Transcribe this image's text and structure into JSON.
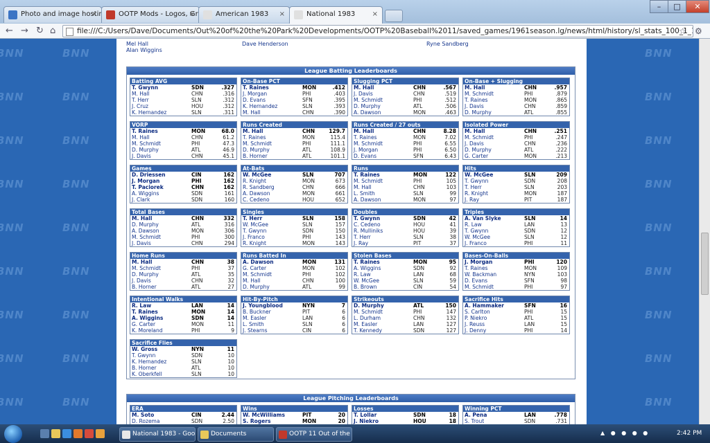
{
  "browser": {
    "tabs": [
      {
        "label": "Photo and image hosting,",
        "icon_color": "#3b74c4"
      },
      {
        "label": "OOTP Mods - Logos, Grap",
        "icon_color": "#c0392b"
      },
      {
        "label": "American 1983",
        "icon_color": "#e0e0e0"
      },
      {
        "label": "National 1983",
        "icon_color": "#e0e0e0"
      }
    ],
    "url": "file:///C:/Users/Dave/Documents/Out%20of%20the%20Park%20Developments/OOTP%20Baseball%2011/saved_games/1961season.lg/news/html/history/sl_stats_100_1_1983.html"
  },
  "top_names": {
    "col1": [
      "Mel Hall",
      "Alan Wiggins"
    ],
    "col2": [
      "Dave Henderson"
    ],
    "col3": [
      "Ryne Sandberg"
    ]
  },
  "watermark": "BNN",
  "batting": {
    "title": "League Batting Leaderboards",
    "boxes": [
      {
        "title": "Batting AVG",
        "rows": [
          [
            "T. Gwynn",
            "SDN",
            ".327"
          ],
          [
            "M. Hall",
            "CHN",
            ".316"
          ],
          [
            "T. Herr",
            "SLN",
            ".312"
          ],
          [
            "J. Cruz",
            "HOU",
            ".312"
          ],
          [
            "K. Hernandez",
            "SLN",
            ".311"
          ]
        ]
      },
      {
        "title": "On-Base PCT",
        "rows": [
          [
            "T. Raines",
            "MON",
            ".412"
          ],
          [
            "J. Morgan",
            "PHI",
            ".403"
          ],
          [
            "D. Evans",
            "SFN",
            ".395"
          ],
          [
            "K. Hernandez",
            "SLN",
            ".393"
          ],
          [
            "M. Hall",
            "CHN",
            ".390"
          ]
        ]
      },
      {
        "title": "Slugging PCT",
        "rows": [
          [
            "M. Hall",
            "CHN",
            ".567"
          ],
          [
            "J. Davis",
            "CHN",
            ".519"
          ],
          [
            "M. Schmidt",
            "PHI",
            ".512"
          ],
          [
            "D. Murphy",
            "ATL",
            ".506"
          ],
          [
            "A. Dawson",
            "MON",
            ".463"
          ]
        ]
      },
      {
        "title": "On-Base + Slugging",
        "rows": [
          [
            "M. Hall",
            "CHN",
            ".957"
          ],
          [
            "M. Schmidt",
            "PHI",
            ".879"
          ],
          [
            "T. Raines",
            "MON",
            ".865"
          ],
          [
            "J. Davis",
            "CHN",
            ".859"
          ],
          [
            "D. Murphy",
            "ATL",
            ".855"
          ]
        ]
      },
      {
        "title": "VORP",
        "rows": [
          [
            "T. Raines",
            "MON",
            "68.0"
          ],
          [
            "M. Hall",
            "CHN",
            "61.2"
          ],
          [
            "M. Schmidt",
            "PHI",
            "47.3"
          ],
          [
            "D. Murphy",
            "ATL",
            "46.9"
          ],
          [
            "J. Davis",
            "CHN",
            "45.1"
          ]
        ]
      },
      {
        "title": "Runs Created",
        "rows": [
          [
            "M. Hall",
            "CHN",
            "129.7"
          ],
          [
            "T. Raines",
            "MON",
            "115.4"
          ],
          [
            "M. Schmidt",
            "PHI",
            "111.1"
          ],
          [
            "D. Murphy",
            "ATL",
            "108.9"
          ],
          [
            "B. Horner",
            "ATL",
            "101.1"
          ]
        ]
      },
      {
        "title": "Runs Created / 27 outs",
        "rows": [
          [
            "M. Hall",
            "CHN",
            "8.28"
          ],
          [
            "T. Raines",
            "MON",
            "7.02"
          ],
          [
            "M. Schmidt",
            "PHI",
            "6.55"
          ],
          [
            "J. Morgan",
            "PHI",
            "6.50"
          ],
          [
            "D. Evans",
            "SFN",
            "6.43"
          ]
        ]
      },
      {
        "title": "Isolated Power",
        "rows": [
          [
            "M. Hall",
            "CHN",
            ".251"
          ],
          [
            "M. Schmidt",
            "PHI",
            ".247"
          ],
          [
            "J. Davis",
            "CHN",
            ".236"
          ],
          [
            "D. Murphy",
            "ATL",
            ".222"
          ],
          [
            "G. Carter",
            "MON",
            ".213"
          ]
        ]
      },
      {
        "title": "Games",
        "rows": [
          [
            "D. Driessen",
            "CIN",
            "162"
          ],
          [
            "J. Morgan",
            "PHI",
            "162"
          ],
          [
            "T. Paciorek",
            "CHN",
            "162"
          ],
          [
            "A. Wiggins",
            "SDN",
            "161"
          ],
          [
            "J. Clark",
            "SDN",
            "160"
          ]
        ],
        "leads": 3
      },
      {
        "title": "At-Bats",
        "rows": [
          [
            "W. McGee",
            "SLN",
            "707"
          ],
          [
            "R. Knight",
            "MON",
            "673"
          ],
          [
            "R. Sandberg",
            "CHN",
            "666"
          ],
          [
            "A. Dawson",
            "MON",
            "661"
          ],
          [
            "C. Cedeno",
            "HOU",
            "652"
          ]
        ]
      },
      {
        "title": "Runs",
        "rows": [
          [
            "T. Raines",
            "MON",
            "122"
          ],
          [
            "M. Schmidt",
            "PHI",
            "105"
          ],
          [
            "M. Hall",
            "CHN",
            "103"
          ],
          [
            "L. Smith",
            "SLN",
            "99"
          ],
          [
            "A. Dawson",
            "MON",
            "97"
          ]
        ]
      },
      {
        "title": "Hits",
        "rows": [
          [
            "W. McGee",
            "SLN",
            "209"
          ],
          [
            "T. Gwynn",
            "SDN",
            "208"
          ],
          [
            "T. Herr",
            "SLN",
            "203"
          ],
          [
            "R. Knight",
            "MON",
            "187"
          ],
          [
            "J. Ray",
            "PIT",
            "187"
          ]
        ]
      },
      {
        "title": "Total Bases",
        "rows": [
          [
            "M. Hall",
            "CHN",
            "332"
          ],
          [
            "D. Murphy",
            "ATL",
            "316"
          ],
          [
            "A. Dawson",
            "MON",
            "306"
          ],
          [
            "M. Schmidt",
            "PHI",
            "300"
          ],
          [
            "J. Davis",
            "CHN",
            "294"
          ]
        ]
      },
      {
        "title": "Singles",
        "rows": [
          [
            "T. Herr",
            "SLN",
            "158"
          ],
          [
            "W. McGee",
            "SLN",
            "157"
          ],
          [
            "T. Gwynn",
            "SDN",
            "150"
          ],
          [
            "J. Franco",
            "PHI",
            "143"
          ],
          [
            "R. Knight",
            "MON",
            "143"
          ]
        ]
      },
      {
        "title": "Doubles",
        "rows": [
          [
            "T. Gwynn",
            "SDN",
            "42"
          ],
          [
            "C. Cedeno",
            "HOU",
            "41"
          ],
          [
            "R. Mulliniks",
            "HOU",
            "39"
          ],
          [
            "T. Herr",
            "SLN",
            "38"
          ],
          [
            "J. Ray",
            "PIT",
            "37"
          ]
        ]
      },
      {
        "title": "Triples",
        "rows": [
          [
            "A. Van Slyke",
            "SLN",
            "14"
          ],
          [
            "R. Law",
            "LAN",
            "13"
          ],
          [
            "T. Gwynn",
            "SDN",
            "12"
          ],
          [
            "W. McGee",
            "SLN",
            "12"
          ],
          [
            "J. Franco",
            "PHI",
            "11"
          ]
        ]
      },
      {
        "title": "Home Runs",
        "rows": [
          [
            "M. Hall",
            "CHN",
            "38"
          ],
          [
            "M. Schmidt",
            "PHI",
            "37"
          ],
          [
            "D. Murphy",
            "ATL",
            "35"
          ],
          [
            "J. Davis",
            "CHN",
            "32"
          ],
          [
            "B. Horner",
            "ATL",
            "27"
          ]
        ]
      },
      {
        "title": "Runs Batted In",
        "rows": [
          [
            "A. Dawson",
            "MON",
            "131"
          ],
          [
            "G. Carter",
            "MON",
            "102"
          ],
          [
            "M. Schmidt",
            "PHI",
            "102"
          ],
          [
            "M. Hall",
            "CHN",
            "100"
          ],
          [
            "D. Murphy",
            "ATL",
            "99"
          ]
        ]
      },
      {
        "title": "Stolen Bases",
        "rows": [
          [
            "T. Raines",
            "MON",
            "95"
          ],
          [
            "A. Wiggins",
            "SDN",
            "92"
          ],
          [
            "R. Law",
            "LAN",
            "68"
          ],
          [
            "W. McGee",
            "SLN",
            "59"
          ],
          [
            "B. Brown",
            "CIN",
            "54"
          ]
        ]
      },
      {
        "title": "Bases-On-Balls",
        "rows": [
          [
            "J. Morgan",
            "PHI",
            "120"
          ],
          [
            "T. Raines",
            "MON",
            "109"
          ],
          [
            "W. Backman",
            "NYN",
            "103"
          ],
          [
            "D. Evans",
            "SFN",
            "98"
          ],
          [
            "M. Schmidt",
            "PHI",
            "97"
          ]
        ]
      },
      {
        "title": "Intentional Walks",
        "rows": [
          [
            "R. Law",
            "LAN",
            "14"
          ],
          [
            "T. Raines",
            "MON",
            "14"
          ],
          [
            "A. Wiggins",
            "SDN",
            "14"
          ],
          [
            "G. Carter",
            "MON",
            "11"
          ],
          [
            "K. Moreland",
            "PHI",
            "9"
          ]
        ],
        "leads": 3
      },
      {
        "title": "Hit-By-Pitch",
        "rows": [
          [
            "J. Youngblood",
            "NYN",
            "7"
          ],
          [
            "B. Buckner",
            "PIT",
            "6"
          ],
          [
            "M. Easler",
            "LAN",
            "6"
          ],
          [
            "L. Smith",
            "SLN",
            "6"
          ],
          [
            "J. Stearns",
            "CIN",
            "6"
          ]
        ]
      },
      {
        "title": "Strikeouts",
        "rows": [
          [
            "D. Murphy",
            "ATL",
            "150"
          ],
          [
            "M. Schmidt",
            "PHI",
            "147"
          ],
          [
            "L. Durham",
            "CHN",
            "132"
          ],
          [
            "M. Easler",
            "LAN",
            "127"
          ],
          [
            "T. Kennedy",
            "SDN",
            "127"
          ]
        ]
      },
      {
        "title": "Sacrifice Hits",
        "rows": [
          [
            "A. Hammaker",
            "SFN",
            "16"
          ],
          [
            "S. Carlton",
            "PHI",
            "15"
          ],
          [
            "P. Niekro",
            "ATL",
            "15"
          ],
          [
            "J. Reuss",
            "LAN",
            "15"
          ],
          [
            "J. Denny",
            "PHI",
            "14"
          ]
        ]
      },
      {
        "title": "Sacrifice Flies",
        "rows": [
          [
            "W. Gross",
            "NYN",
            "11"
          ],
          [
            "T. Gwynn",
            "SDN",
            "10"
          ],
          [
            "K. Hernandez",
            "SLN",
            "10"
          ],
          [
            "B. Horner",
            "ATL",
            "10"
          ],
          [
            "K. Oberkfell",
            "SLN",
            "10"
          ]
        ]
      }
    ]
  },
  "pitching": {
    "title": "League Pitching Leaderboards",
    "boxes": [
      {
        "title": "ERA",
        "rows": [
          [
            "M. Soto",
            "CIN",
            "2.44"
          ],
          [
            "D. Rozema",
            "SDN",
            "2.50"
          ]
        ]
      },
      {
        "title": "Wins",
        "rows": [
          [
            "W. McWilliams",
            "PIT",
            "20"
          ],
          [
            "S. Rogers",
            "MON",
            "20"
          ]
        ],
        "leads": 2
      },
      {
        "title": "Losses",
        "rows": [
          [
            "T. Lollar",
            "SDN",
            "18"
          ],
          [
            "J. Niekro",
            "HOU",
            "18"
          ]
        ],
        "leads": 2
      },
      {
        "title": "Winning PCT",
        "rows": [
          [
            "A. Pena",
            "LAN",
            ".778"
          ],
          [
            "S. Trout",
            "SDN",
            ".731"
          ]
        ]
      }
    ]
  },
  "taskbar": {
    "tasks": [
      {
        "label": "National 1983 - Goo...",
        "icon_color": "#e8e8e8"
      },
      {
        "label": "Documents",
        "icon_color": "#e8c85a"
      },
      {
        "label": "OOTP 11 Out of the ...",
        "icon_color": "#c0392b"
      }
    ],
    "clock": "2:42 PM"
  }
}
